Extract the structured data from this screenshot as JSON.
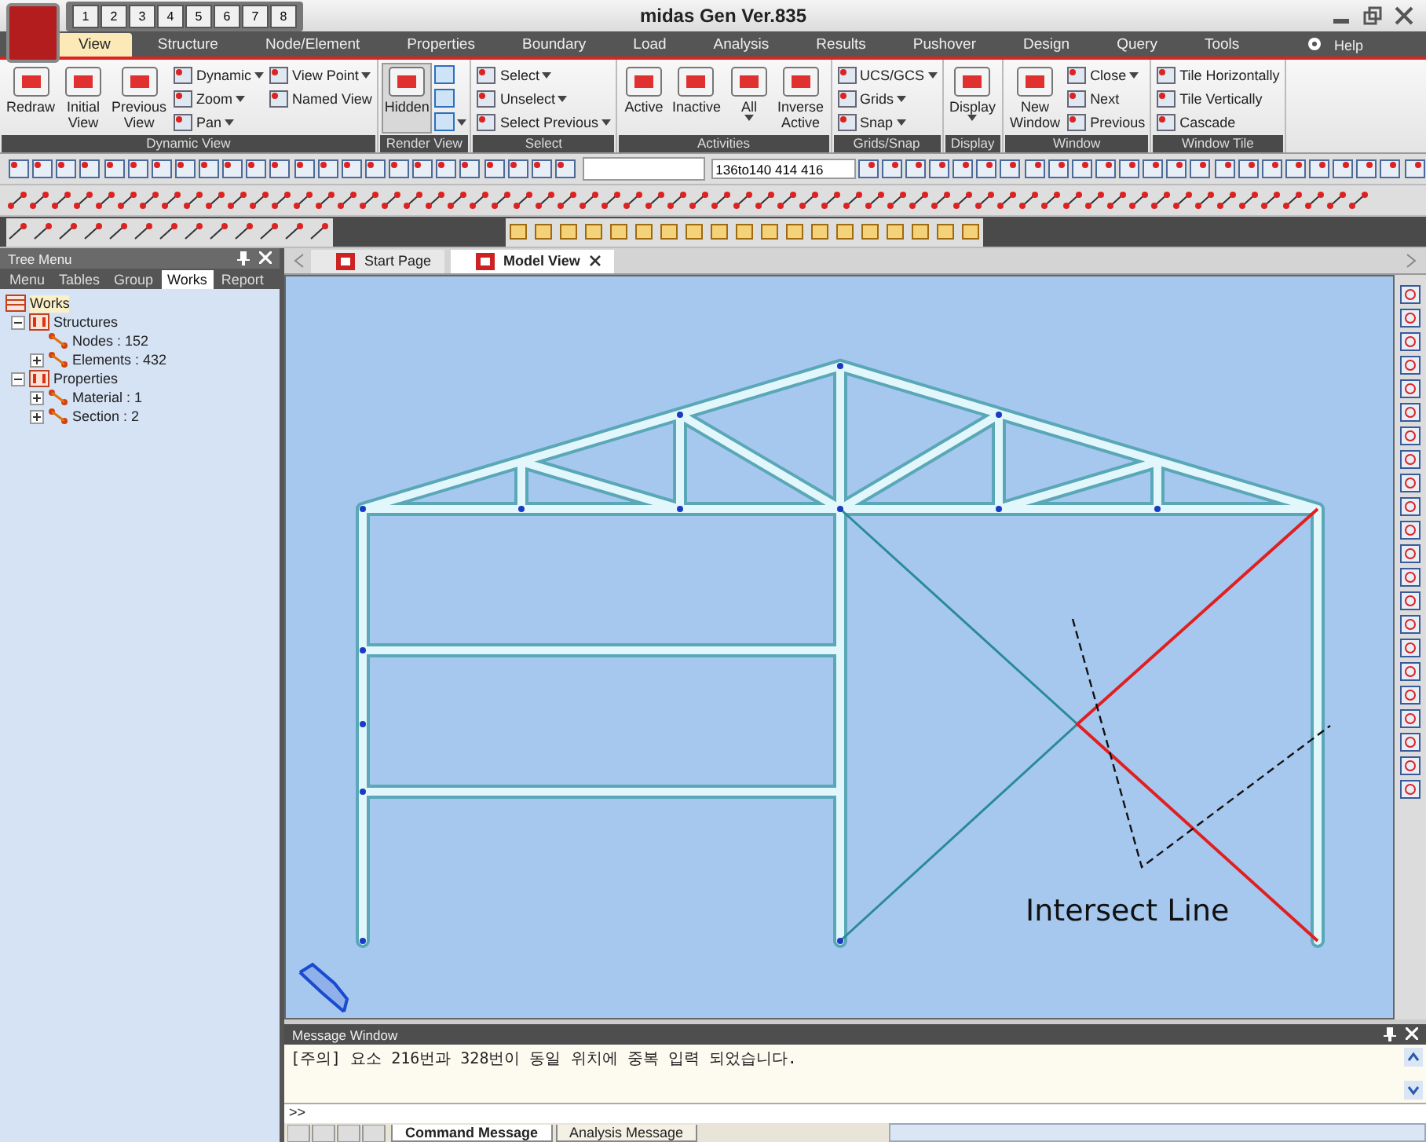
{
  "window": {
    "title": "midas Gen Ver.835"
  },
  "quick_access": [
    "1",
    "2",
    "3",
    "4",
    "5",
    "6",
    "7",
    "8"
  ],
  "menu_tabs": [
    {
      "label": "View",
      "selected": true
    },
    {
      "label": "Structure",
      "selected": false
    },
    {
      "label": "Node/Element",
      "selected": false
    },
    {
      "label": "Properties",
      "selected": false
    },
    {
      "label": "Boundary",
      "selected": false
    },
    {
      "label": "Load",
      "selected": false
    },
    {
      "label": "Analysis",
      "selected": false
    },
    {
      "label": "Results",
      "selected": false
    },
    {
      "label": "Pushover",
      "selected": false
    },
    {
      "label": "Design",
      "selected": false
    },
    {
      "label": "Query",
      "selected": false
    },
    {
      "label": "Tools",
      "selected": false
    }
  ],
  "help": "Help",
  "ribbon_groups": [
    {
      "title": "Dynamic View",
      "items": [
        {
          "kind": "large",
          "label": "Redraw",
          "dropdown": false,
          "selected": false
        },
        {
          "kind": "large",
          "label": "Initial\nView",
          "dropdown": false,
          "selected": false
        },
        {
          "kind": "large",
          "label": "Previous\nView",
          "dropdown": false,
          "selected": false
        },
        {
          "kind": "small",
          "label": "Dynamic",
          "dropdown": true
        },
        {
          "kind": "small",
          "label": "Zoom",
          "dropdown": true
        },
        {
          "kind": "small",
          "label": "Pan",
          "dropdown": true
        },
        {
          "kind": "small",
          "label": "View Point",
          "dropdown": true
        },
        {
          "kind": "small",
          "label": "Named View",
          "dropdown": false
        }
      ]
    },
    {
      "title": "Render View",
      "items": [
        {
          "kind": "large",
          "label": "Hidden",
          "dropdown": false,
          "selected": true
        },
        {
          "kind": "icon",
          "dropdown": false
        },
        {
          "kind": "icon",
          "dropdown": false
        },
        {
          "kind": "icon",
          "dropdown": true
        }
      ]
    },
    {
      "title": "Select",
      "items": [
        {
          "kind": "small",
          "label": "Select",
          "dropdown": true
        },
        {
          "kind": "small",
          "label": "Unselect",
          "dropdown": true
        },
        {
          "kind": "small",
          "label": "Select Previous",
          "dropdown": true
        }
      ]
    },
    {
      "title": "Activities",
      "items": [
        {
          "kind": "large",
          "label": "Active",
          "dropdown": false,
          "selected": false
        },
        {
          "kind": "large",
          "label": "Inactive",
          "dropdown": false,
          "selected": false
        },
        {
          "kind": "large",
          "label": "All",
          "dropdown": true,
          "selected": false
        },
        {
          "kind": "large",
          "label": "Inverse\nActive",
          "dropdown": false,
          "selected": false
        }
      ]
    },
    {
      "title": "Grids/Snap",
      "items": [
        {
          "kind": "small",
          "label": "UCS/GCS",
          "dropdown": true
        },
        {
          "kind": "small",
          "label": "Grids",
          "dropdown": true
        },
        {
          "kind": "small",
          "label": "Snap",
          "dropdown": true
        }
      ]
    },
    {
      "title": "Display",
      "items": [
        {
          "kind": "large",
          "label": "Display",
          "dropdown": true,
          "selected": false
        }
      ]
    },
    {
      "title": "Window",
      "items": [
        {
          "kind": "large",
          "label": "New\nWindow",
          "dropdown": false,
          "selected": false
        },
        {
          "kind": "small",
          "label": "Close",
          "dropdown": true
        },
        {
          "kind": "small",
          "label": "Next",
          "dropdown": false
        },
        {
          "kind": "small",
          "label": "Previous",
          "dropdown": false
        }
      ]
    },
    {
      "title": "Window Tile",
      "items": [
        {
          "kind": "small",
          "label": "Tile Horizontally",
          "dropdown": false
        },
        {
          "kind": "small",
          "label": "Tile Vertically",
          "dropdown": false
        },
        {
          "kind": "small",
          "label": "Cascade",
          "dropdown": false
        }
      ]
    }
  ],
  "toolbar": {
    "selection_field": {
      "value": "136to140 414 416"
    }
  },
  "tree_menu": {
    "title": "Tree Menu",
    "tabs": [
      {
        "label": "Menu",
        "selected": false
      },
      {
        "label": "Tables",
        "selected": false
      },
      {
        "label": "Group",
        "selected": false
      },
      {
        "label": "Works",
        "selected": true
      },
      {
        "label": "Report",
        "selected": false
      }
    ],
    "items": [
      {
        "label": "Works",
        "selected": true,
        "children": [
          {
            "label": "Structures",
            "selected": false,
            "expandable": true,
            "expanded": true,
            "children": [
              {
                "label": "Nodes : 152",
                "selected": false,
                "expandable": false
              },
              {
                "label": "Elements : 432",
                "selected": false,
                "expandable": true,
                "expanded": false
              }
            ]
          },
          {
            "label": "Properties",
            "selected": false,
            "expandable": true,
            "expanded": true,
            "children": [
              {
                "label": "Material : 1",
                "selected": false,
                "expandable": true,
                "expanded": false
              },
              {
                "label": "Section : 2",
                "selected": false,
                "expandable": true,
                "expanded": false
              }
            ]
          }
        ]
      }
    ]
  },
  "document_tabs": [
    {
      "label": "Start Page",
      "selected": false
    },
    {
      "label": "Model View",
      "selected": true
    }
  ],
  "model_view": {
    "annotation": "Intersect Line"
  },
  "message_window": {
    "title": "Message Window",
    "messages": [
      "[주의] 요소 216번과 328번이 동일 위치에 중복 입력 되었습니다."
    ],
    "prompt": ">>",
    "tabs": [
      {
        "label": "Command Message",
        "selected": true
      },
      {
        "label": "Analysis Message",
        "selected": false
      }
    ]
  }
}
